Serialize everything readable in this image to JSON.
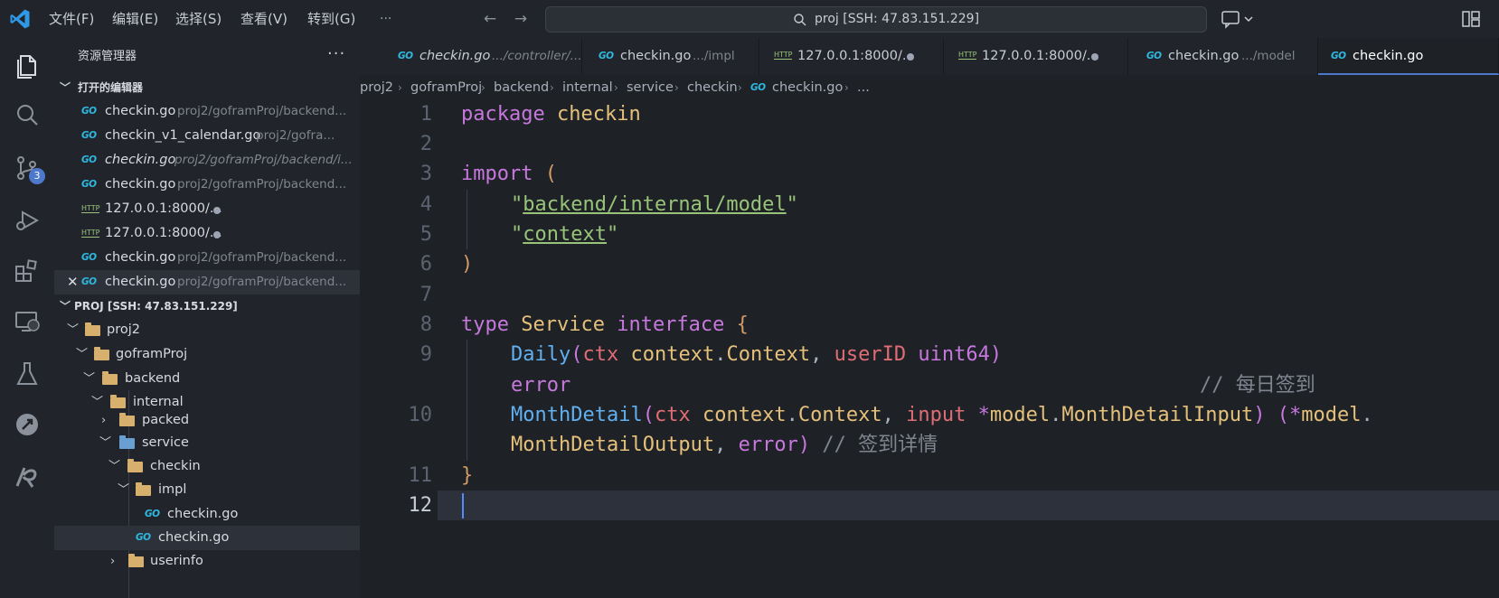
{
  "menu": [
    "文件(F)",
    "编辑(E)",
    "选择(S)",
    "查看(V)",
    "转到(G)",
    "···"
  ],
  "search": {
    "text": "proj [SSH: 47.83.151.229]"
  },
  "activity": {
    "scm_badge": "3"
  },
  "sidebar": {
    "title": "资源管理器",
    "more": "···",
    "open_editors": {
      "label": "打开的编辑器",
      "items": [
        {
          "icon": "GO",
          "name": "checkin.go",
          "path": "proj2/goframProj/backend..."
        },
        {
          "icon": "GO",
          "name": "checkin_v1_calendar.go",
          "path": "proj2/gofra..."
        },
        {
          "icon": "GO",
          "name": "checkin.go",
          "path": "proj2/goframProj/backend/i..."
        },
        {
          "icon": "GO",
          "name": "checkin.go",
          "path": "proj2/goframProj/backend..."
        },
        {
          "icon": "HTTP",
          "name": "127.0.0.1:8000/...",
          "path": ""
        },
        {
          "icon": "HTTP",
          "name": "127.0.0.1:8000/...",
          "path": ""
        },
        {
          "icon": "GO",
          "name": "checkin.go",
          "path": "proj2/goframProj/backend..."
        },
        {
          "icon": "GO",
          "name": "checkin.go",
          "path": "proj2/goframProj/backend..."
        }
      ],
      "close_glyph": "✕"
    },
    "workspace": {
      "label": "PROJ [SSH: 47.83.151.229]",
      "tree": [
        {
          "name": "proj2"
        },
        {
          "name": "goframProj"
        },
        {
          "name": "backend"
        },
        {
          "name": "internal"
        },
        {
          "name": "packed"
        },
        {
          "name": "service"
        },
        {
          "name": "checkin"
        },
        {
          "name": "impl"
        },
        {
          "name": "checkin.go"
        },
        {
          "name": "checkin.go"
        },
        {
          "name": "userinfo"
        }
      ]
    }
  },
  "tabs": [
    {
      "icon": "GO",
      "label": "checkin.go",
      "path": ".../controller/..."
    },
    {
      "icon": "GO",
      "label": "checkin.go",
      "path": ".../impl"
    },
    {
      "icon": "HTTP",
      "label": "127.0.0.1:8000/...",
      "path": ""
    },
    {
      "icon": "HTTP",
      "label": "127.0.0.1:8000/...",
      "path": ""
    },
    {
      "icon": "GO",
      "label": "checkin.go",
      "path": ".../model"
    },
    {
      "icon": "GO",
      "label": "checkin.go",
      "path": ""
    }
  ],
  "breadcrumb": [
    "proj2",
    "goframProj",
    "backend",
    "internal",
    "service",
    "checkin",
    "checkin.go",
    "..."
  ],
  "editor": {
    "line_numbers": [
      "1",
      "2",
      "3",
      "4",
      "5",
      "6",
      "7",
      "8",
      "9",
      "10",
      "11",
      "12"
    ],
    "tokens": {
      "package": "package",
      "pkgname": "checkin",
      "import": "import",
      "lparen": "(",
      "rparen": ")",
      "q": "\"",
      "imp1": "backend/internal/model",
      "imp2": "context",
      "type": "type",
      "Service": "Service",
      "interface": "interface",
      "lbrace": "{",
      "rbrace": "}",
      "Daily": "Daily",
      "ctx": "ctx",
      "contextpkg": "context",
      "dot": ".",
      "Context": "Context",
      "comma": ", ",
      "userID": "userID",
      "uint64": "uint64",
      "error": "error",
      "comment1": "// 每日签到",
      "MonthDetail": "MonthDetail",
      "input": "input",
      "star": "*",
      "model": "model",
      "MonthDetailInput": "MonthDetailInput",
      "MonthDetailOutput": "MonthDetailOutput",
      "comment2": "// 签到详情",
      "space": " "
    }
  },
  "colors": {
    "accent": "#4d78cc",
    "go_icon": "#2fb8e0",
    "http_icon": "#98c379",
    "folder": "#d7b06e"
  }
}
